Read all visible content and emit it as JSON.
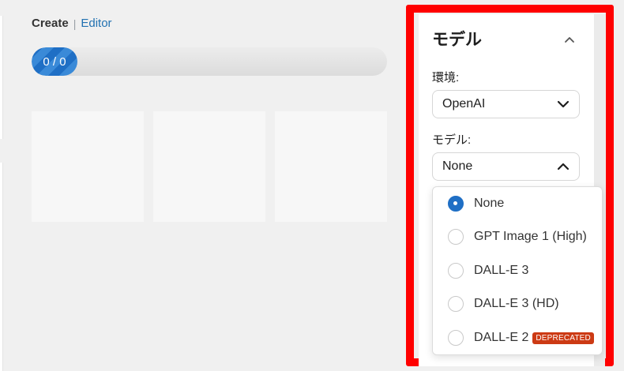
{
  "breadcrumb": {
    "create": "Create",
    "separator": "|",
    "editor": "Editor"
  },
  "progress": {
    "text": "0 / 0",
    "value": 0,
    "max": 0
  },
  "panel": {
    "title": "モデル",
    "environment": {
      "label": "環境:",
      "value": "OpenAI"
    },
    "model": {
      "label": "モデル:",
      "value": "None"
    }
  },
  "model_options": [
    {
      "label": "None",
      "selected": true
    },
    {
      "label": "GPT Image 1 (High)",
      "selected": false
    },
    {
      "label": "DALL-E 3",
      "selected": false
    },
    {
      "label": "DALL-E 3 (HD)",
      "selected": false
    },
    {
      "label": "DALL-E 2",
      "badge": "DEPRECATED",
      "selected": false
    }
  ],
  "colors": {
    "accent": "#1f6fc5",
    "link": "#2271b1",
    "highlight": "#ff0000",
    "badge": "#cc3a14"
  }
}
